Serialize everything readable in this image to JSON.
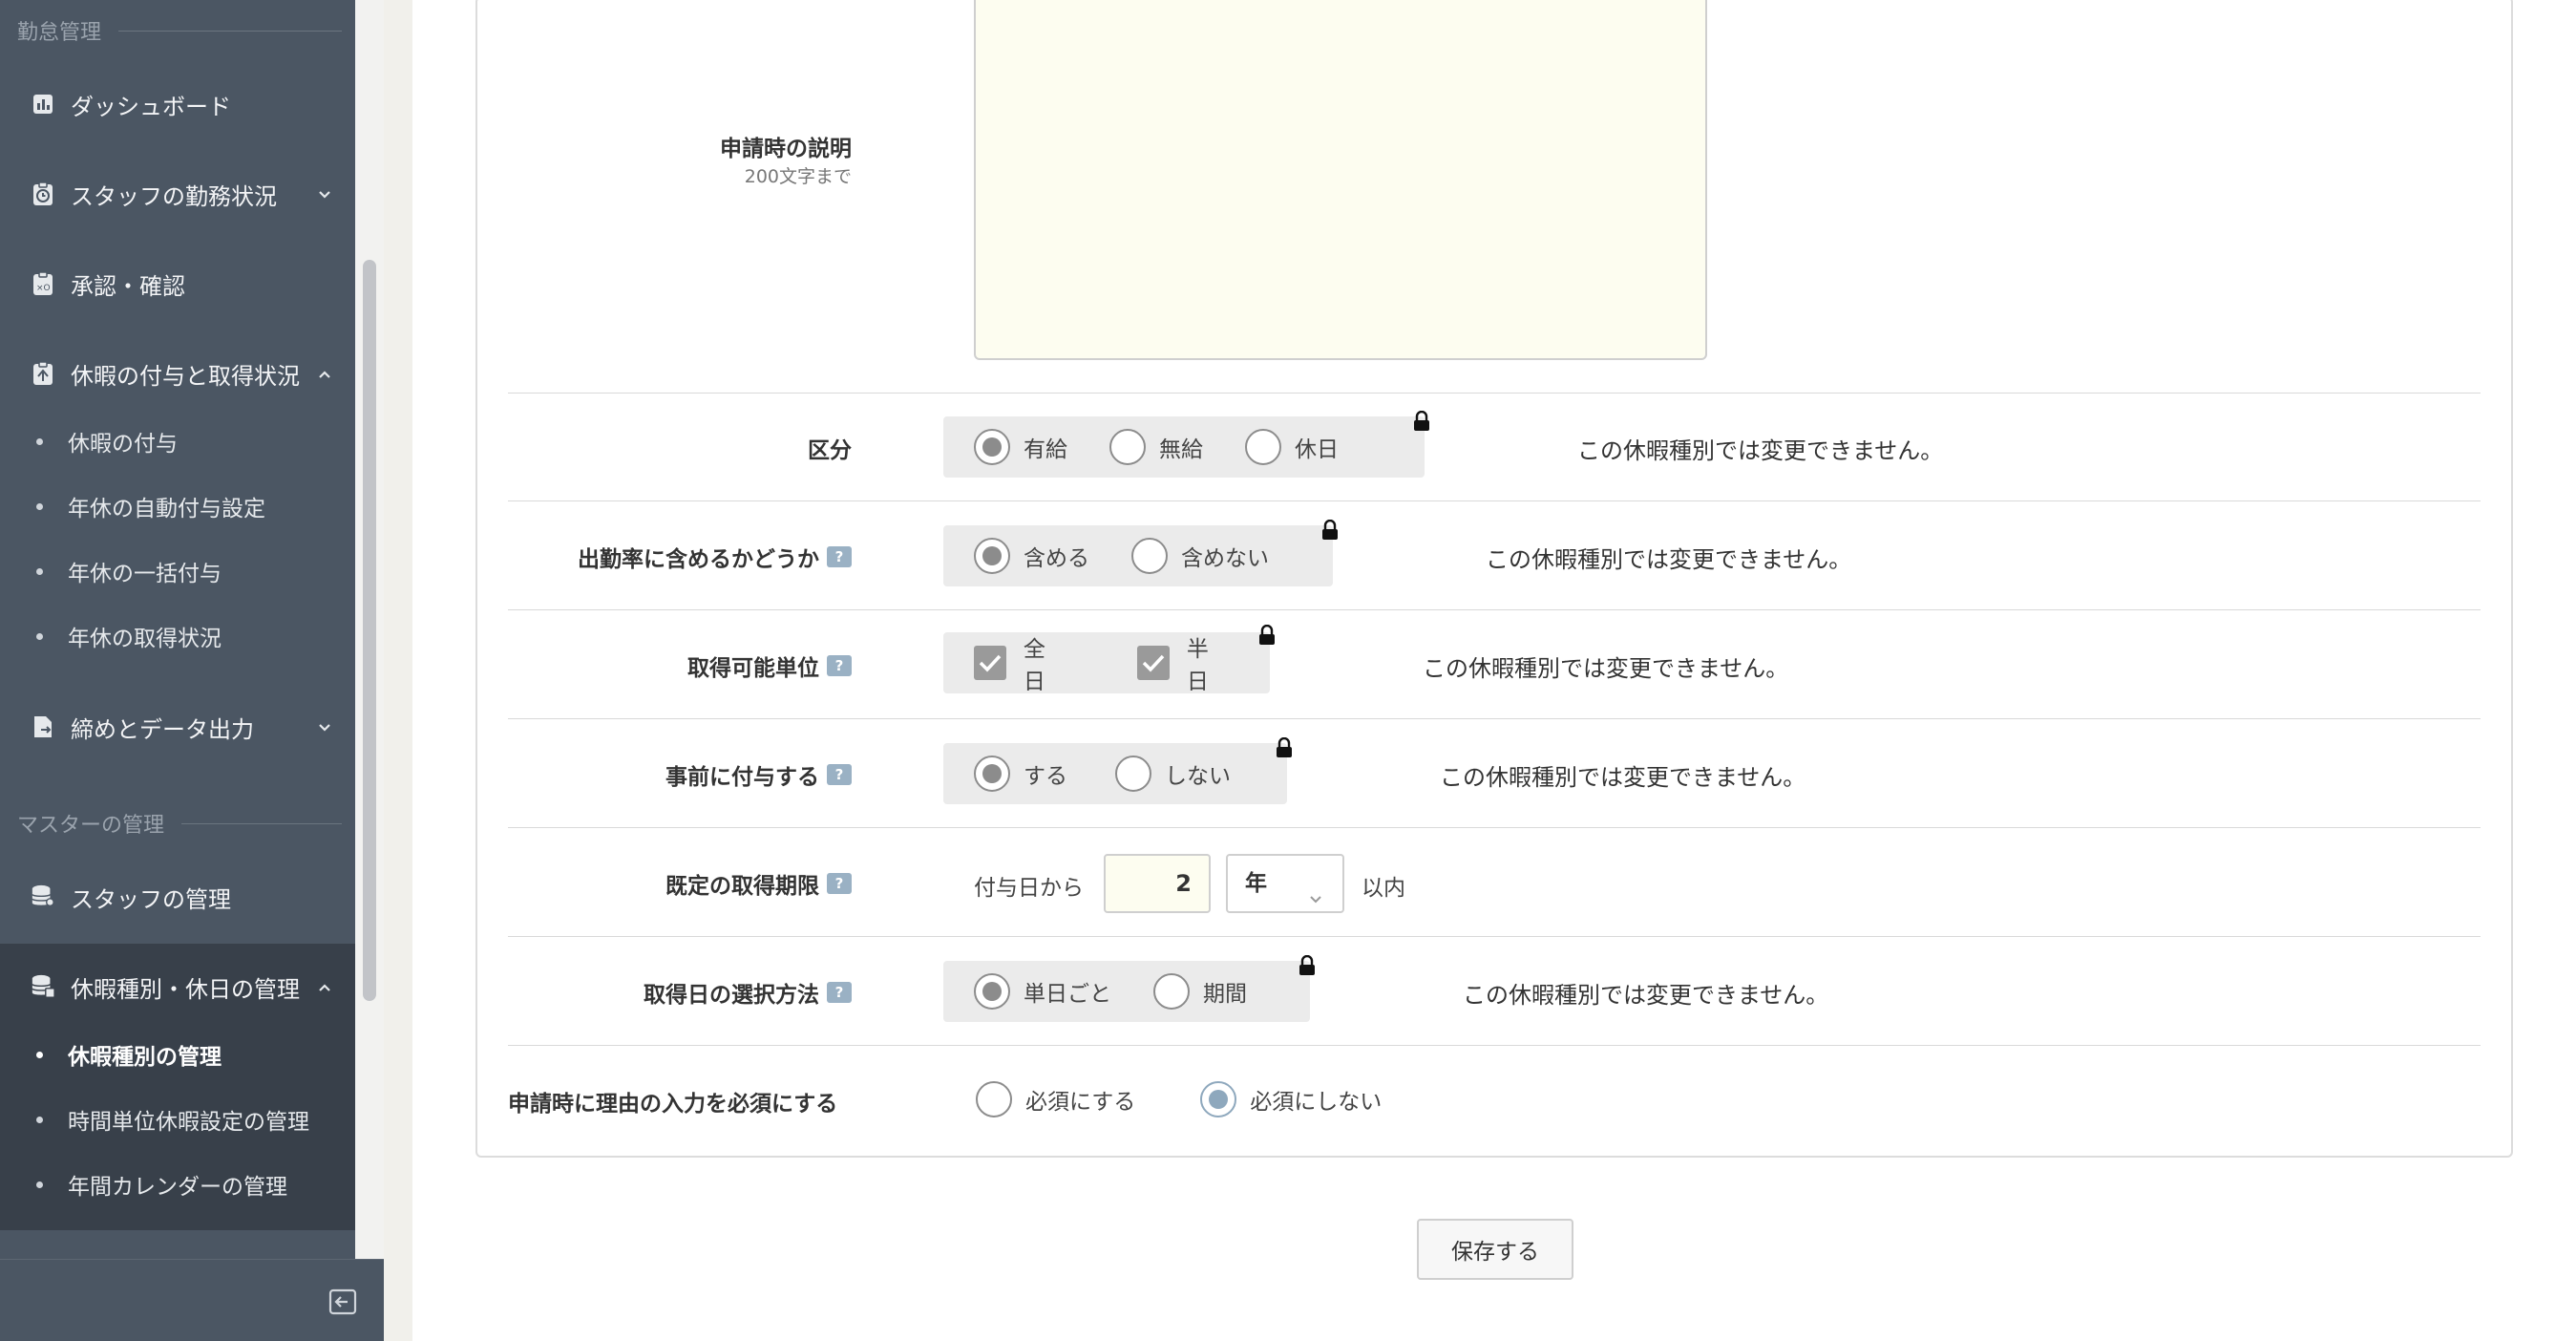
{
  "sidebar": {
    "section_attendance": "勤怠管理",
    "section_master": "マスターの管理",
    "items": {
      "dashboard": "ダッシュボード",
      "staff_status": "スタッフの勤務状況",
      "approval": "承認・確認",
      "leave_grant_status": "休暇の付与と取得状況",
      "leave_grant": "休暇の付与",
      "auto_grant": "年休の自動付与設定",
      "bulk_grant": "年休の一括付与",
      "annual_status": "年休の取得状況",
      "closing_export": "締めとデータ出力",
      "staff_management": "スタッフの管理",
      "leave_type_holiday": "休暇種別・休日の管理",
      "leave_type_mgmt": "休暇種別の管理",
      "hourly_leave_mgmt": "時間単位休暇設定の管理",
      "calendar_mgmt": "年間カレンダーの管理"
    }
  },
  "form": {
    "description": {
      "label": "申請時の説明",
      "sublabel": "200文字まで",
      "value": ""
    },
    "category": {
      "label": "区分",
      "options": [
        "有給",
        "無給",
        "休日"
      ],
      "selected": "有給"
    },
    "attendance_rate": {
      "label": "出勤率に含めるかどうか",
      "options": [
        "含める",
        "含めない"
      ],
      "selected": "含める"
    },
    "unit": {
      "label": "取得可能単位",
      "options": [
        "全日",
        "半日"
      ]
    },
    "advance_grant": {
      "label": "事前に付与する",
      "options": [
        "する",
        "しない"
      ],
      "selected": "する"
    },
    "expiry": {
      "label": "既定の取得期限",
      "prefix": "付与日から",
      "value": "2",
      "unit": "年",
      "suffix": "以内"
    },
    "date_selection": {
      "label": "取得日の選択方法",
      "options": [
        "単日ごと",
        "期間"
      ],
      "selected": "単日ごと"
    },
    "reason_required": {
      "label": "申請時に理由の入力を必須にする",
      "options": [
        "必須にする",
        "必須にしない"
      ],
      "selected": "必須にしない"
    },
    "locked_note": "この休暇種別では変更できません。",
    "help_mark": "?"
  },
  "save_button": "保存する",
  "colors": {
    "sidebar": "#4b5663",
    "sidebar_active": "#38404a",
    "input_bg": "#fdfdf0",
    "help": "#9ab1c4"
  }
}
